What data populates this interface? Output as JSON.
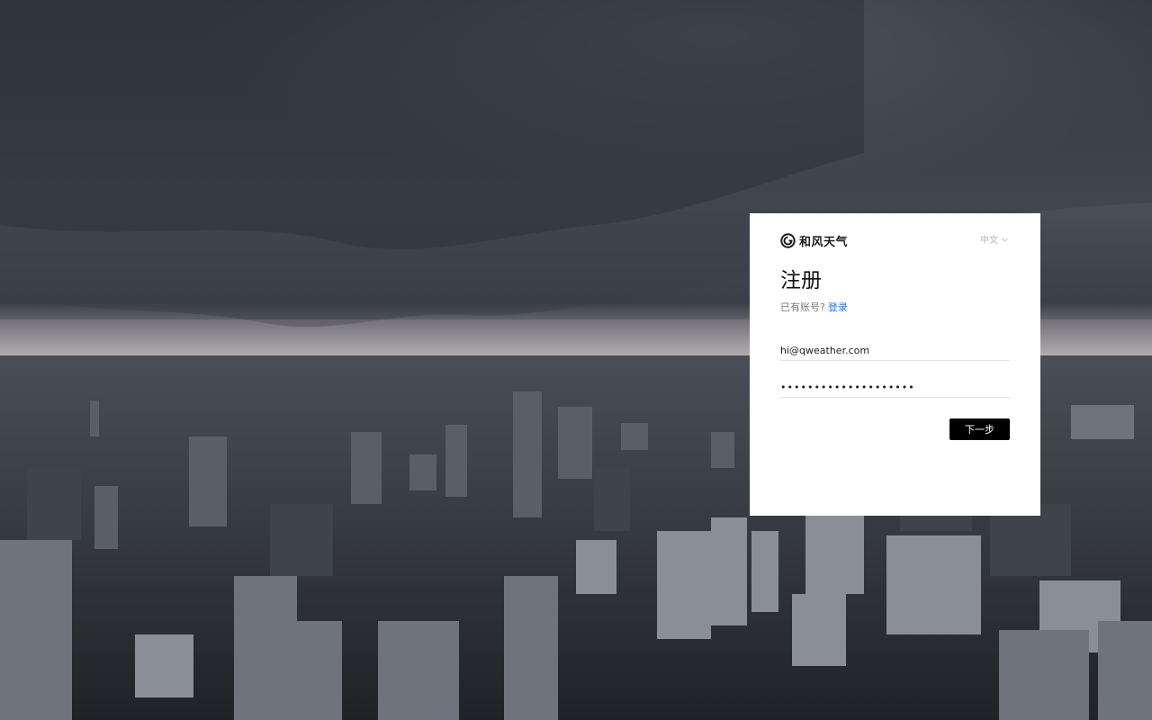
{
  "brand": {
    "name": "和风天气",
    "logo_icon": "qweather-logo-icon"
  },
  "language": {
    "selected": "中文",
    "icon": "chevron-down-icon"
  },
  "form": {
    "title": "注册",
    "has_account_text": "已有账号?",
    "login_link": "登录",
    "email_value": "hi@qweather.com",
    "password_value": "••••••••••••••••••••",
    "next_button": "下一步"
  },
  "colors": {
    "link": "#2f6fe0",
    "button_bg": "#000000",
    "card_bg": "#ffffff"
  }
}
